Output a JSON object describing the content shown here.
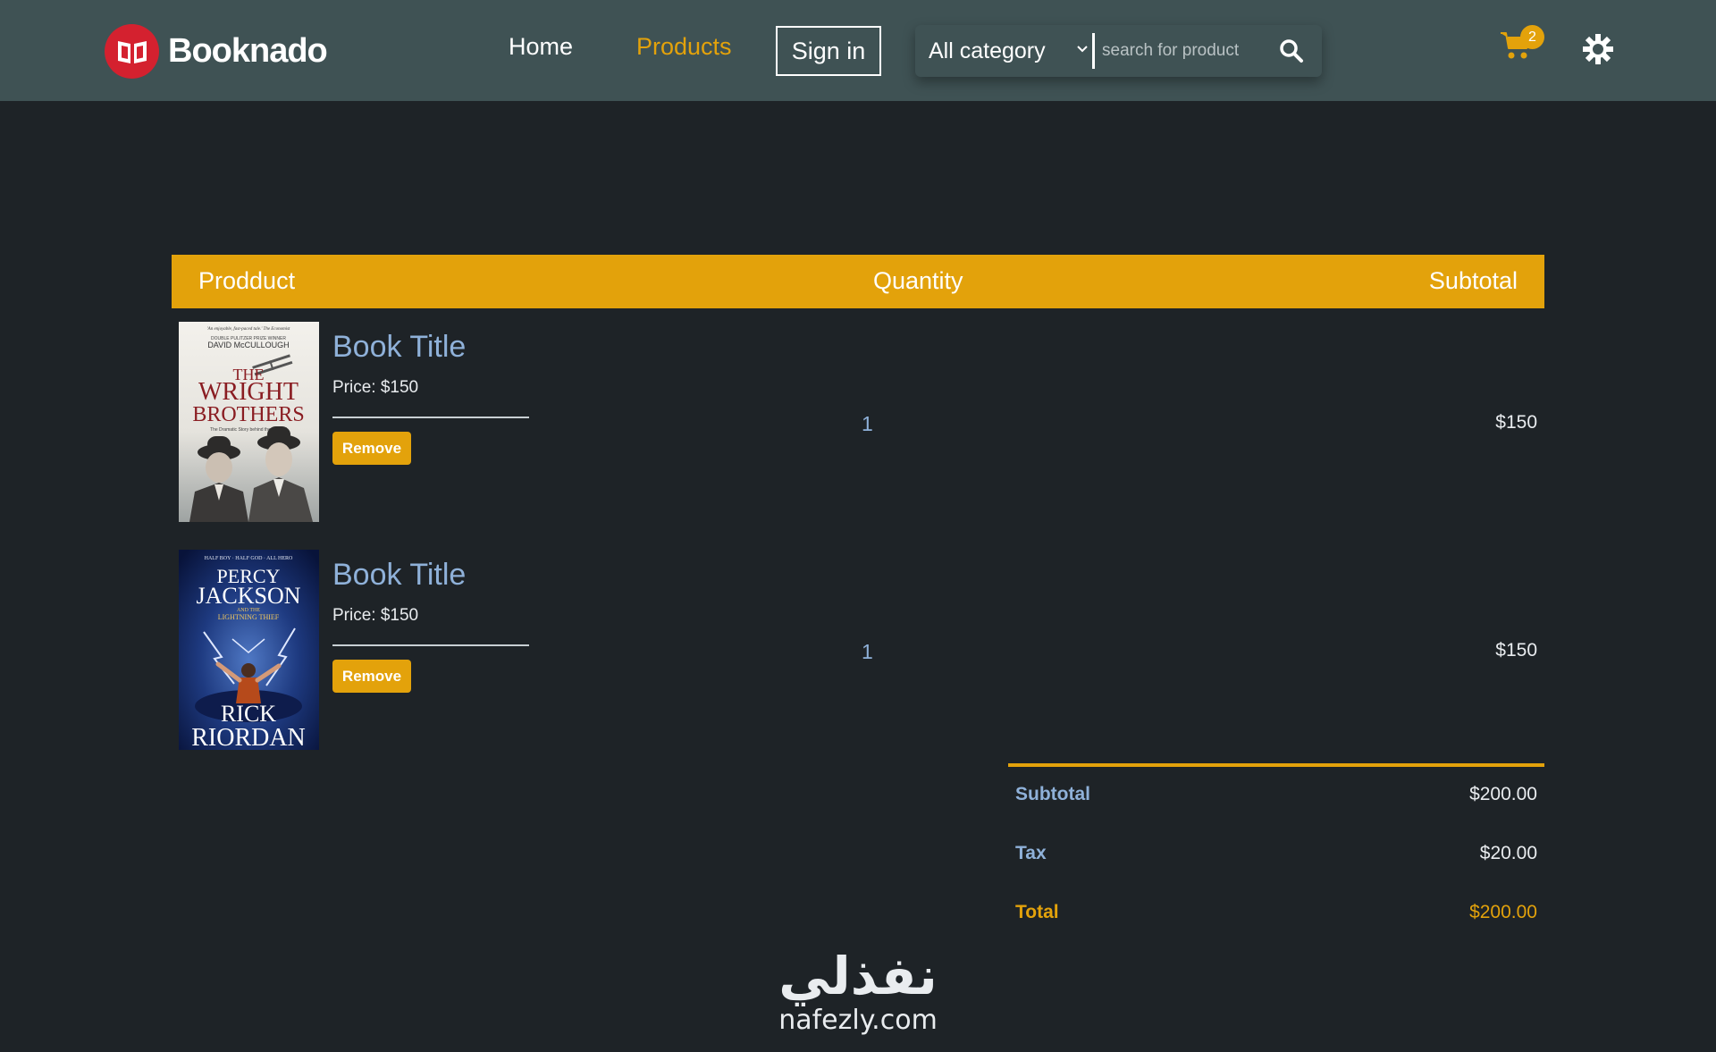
{
  "brand": {
    "name": "Booknado",
    "logo_icon": "open-book-icon",
    "logo_color": "#d4212f"
  },
  "nav": {
    "home": "Home",
    "products": "Products",
    "sign_in": "Sign in",
    "active_color": "#e3a20b"
  },
  "search": {
    "category": "All category",
    "placeholder": "search for product",
    "value": ""
  },
  "cart": {
    "count": "2",
    "icon": "shopping-cart-icon"
  },
  "theme_toggle_icon": "sun-icon",
  "table": {
    "headers": {
      "product": "Prodduct",
      "quantity": "Quantity",
      "subtotal": "Subtotal"
    },
    "items": [
      {
        "title": "Book Title",
        "price": "Price: $150",
        "remove": "Remove",
        "quantity": "1",
        "subtotal": "$150",
        "cover": {
          "tagline": "'An enjoyable, fast-paced tale.' The Economist",
          "award": "DOUBLE PULITZER PRIZE WINNER",
          "author": "DAVID McCULLOUGH",
          "title_line1": "THE",
          "title_line2": "WRIGHT",
          "title_line3": "BROTHERS",
          "subtitle": "The Dramatic Story behind the Legend"
        }
      },
      {
        "title": "Book Title",
        "price": "Price: $150",
        "remove": "Remove",
        "quantity": "1",
        "subtotal": "$150",
        "cover": {
          "tagline": "HALF BOY · HALF GOD · ALL HERO",
          "title_line1": "PERCY",
          "title_line2": "JACKSON",
          "title_line3": "AND THE",
          "title_line4": "LIGHTNING THIEF",
          "author_line1": "RICK",
          "author_line2": "RIORDAN"
        }
      }
    ]
  },
  "totals": {
    "subtotal_label": "Subtotal",
    "subtotal": "$200.00",
    "tax_label": "Tax",
    "tax": "$20.00",
    "total_label": "Total",
    "total": "$200.00"
  },
  "watermark": {
    "arabic": "نفذلي",
    "latin": "nafezly.com"
  },
  "colors": {
    "navbar": "#3f5254",
    "background": "#1e2327",
    "accent": "#e3a20b",
    "link_blue": "#8fb1d9"
  }
}
